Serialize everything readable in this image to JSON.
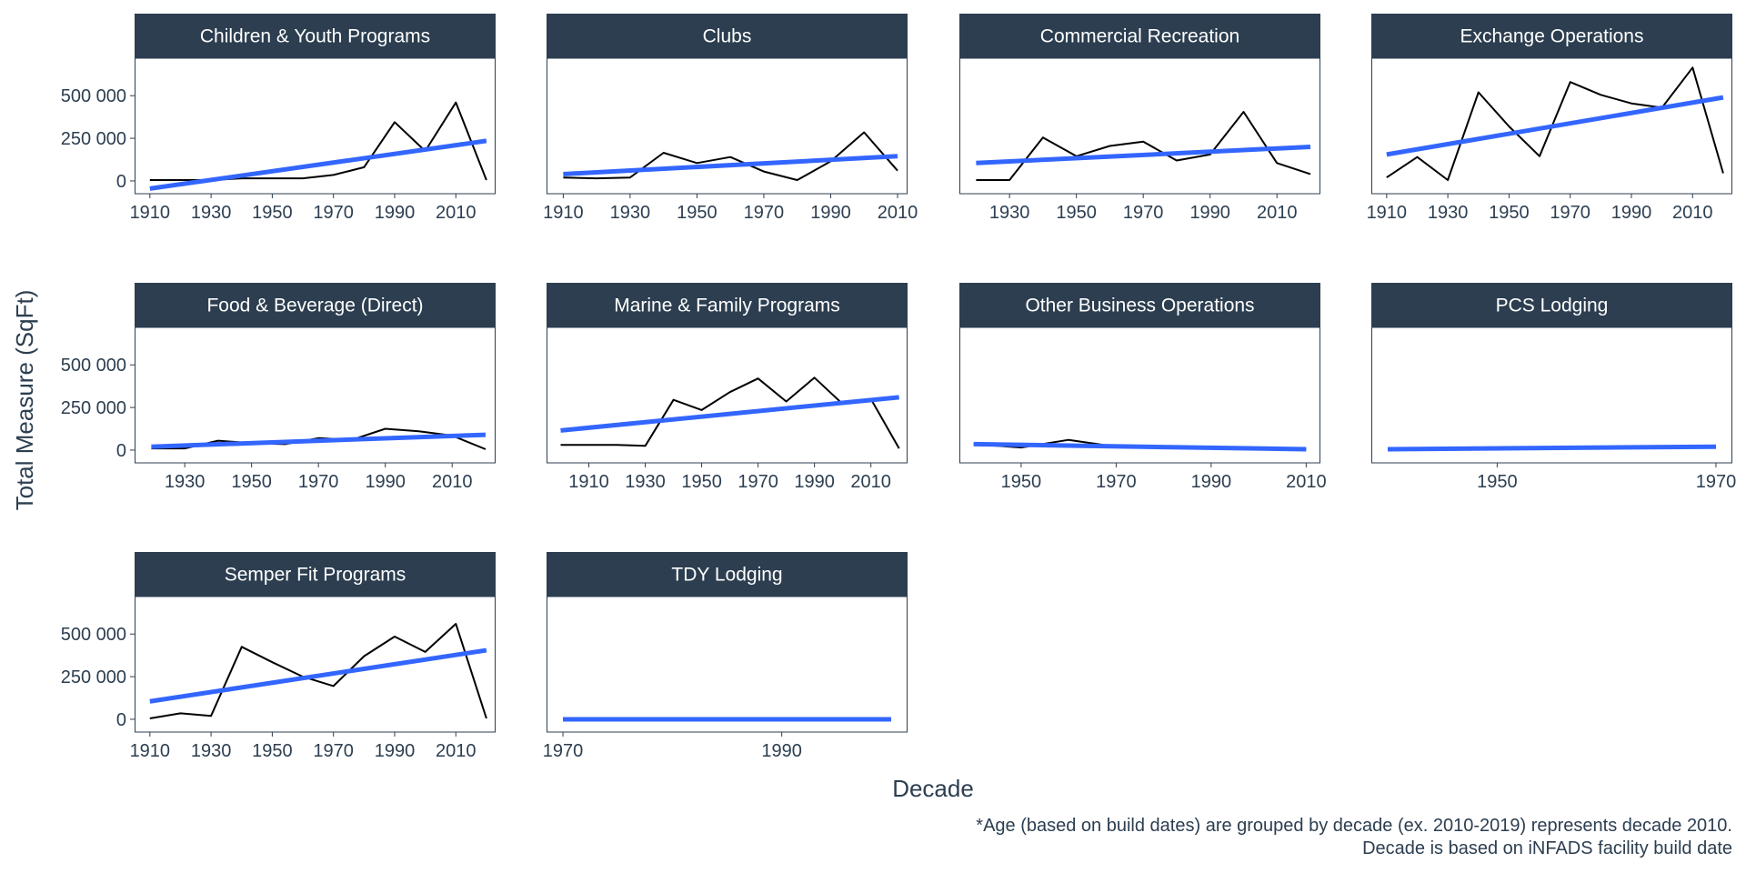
{
  "chart_data": {
    "type": "line",
    "facet": "wrap",
    "ncol": 4,
    "xlabel": "Decade",
    "ylabel": "Total Measure (SqFt)",
    "y_ticks": [
      0,
      250000,
      500000
    ],
    "y_tick_labels": [
      "0",
      "250 000",
      "500 000"
    ],
    "ylim": [
      -75000,
      720000
    ],
    "colors": {
      "data_line": "#000000",
      "trend_line": "#3366ff",
      "strip": "#2c3e50",
      "text": "#2c3e50"
    },
    "panels": [
      {
        "title": "Children & Youth Programs",
        "xlim": [
          1905,
          2023
        ],
        "x_ticks": [
          1910,
          1930,
          1950,
          1970,
          1990,
          2010
        ],
        "x": [
          1910,
          1920,
          1930,
          1940,
          1950,
          1960,
          1970,
          1980,
          1990,
          2000,
          2010,
          2020
        ],
        "y": [
          5000,
          5000,
          5000,
          15000,
          15000,
          15000,
          35000,
          80000,
          345000,
          175000,
          460000,
          5000
        ],
        "trend": [
          [
            1910,
            -45000
          ],
          [
            2020,
            235000
          ]
        ]
      },
      {
        "title": "Clubs",
        "xlim": [
          1905,
          2013
        ],
        "x_ticks": [
          1910,
          1930,
          1950,
          1970,
          1990,
          2010
        ],
        "x": [
          1910,
          1920,
          1930,
          1940,
          1950,
          1960,
          1970,
          1980,
          1990,
          2000,
          2010
        ],
        "y": [
          20000,
          15000,
          20000,
          165000,
          105000,
          140000,
          55000,
          5000,
          115000,
          285000,
          60000
        ],
        "trend": [
          [
            1910,
            40000
          ],
          [
            2010,
            145000
          ]
        ]
      },
      {
        "title": "Commercial Recreation",
        "xlim": [
          1915,
          2023
        ],
        "x_ticks": [
          1930,
          1950,
          1970,
          1990,
          2010
        ],
        "x": [
          1920,
          1930,
          1940,
          1950,
          1960,
          1970,
          1980,
          1990,
          2000,
          2010,
          2020
        ],
        "y": [
          5000,
          5000,
          255000,
          145000,
          205000,
          230000,
          120000,
          155000,
          405000,
          105000,
          40000
        ],
        "trend": [
          [
            1920,
            105000
          ],
          [
            2020,
            200000
          ]
        ]
      },
      {
        "title": "Exchange Operations",
        "xlim": [
          1905,
          2023
        ],
        "x_ticks": [
          1910,
          1930,
          1950,
          1970,
          1990,
          2010
        ],
        "x": [
          1910,
          1920,
          1930,
          1940,
          1950,
          1960,
          1970,
          1980,
          1990,
          2000,
          2010,
          2020
        ],
        "y": [
          20000,
          140000,
          5000,
          520000,
          320000,
          145000,
          580000,
          505000,
          455000,
          430000,
          665000,
          45000
        ],
        "trend": [
          [
            1910,
            155000
          ],
          [
            2020,
            490000
          ]
        ]
      },
      {
        "title": "Food & Beverage (Direct)",
        "xlim": [
          1915,
          2023
        ],
        "x_ticks": [
          1930,
          1950,
          1970,
          1990,
          2010
        ],
        "x": [
          1920,
          1930,
          1940,
          1950,
          1960,
          1970,
          1980,
          1990,
          2000,
          2010,
          2020
        ],
        "y": [
          10000,
          10000,
          55000,
          40000,
          35000,
          70000,
          60000,
          125000,
          110000,
          85000,
          5000
        ],
        "trend": [
          [
            1920,
            20000
          ],
          [
            2020,
            90000
          ]
        ]
      },
      {
        "title": "Marine & Family Programs",
        "xlim": [
          1895,
          2023
        ],
        "x_ticks": [
          1910,
          1930,
          1950,
          1970,
          1990,
          2010
        ],
        "x": [
          1900,
          1910,
          1920,
          1930,
          1940,
          1950,
          1960,
          1970,
          1980,
          1990,
          2000,
          2010,
          2020
        ],
        "y": [
          30000,
          30000,
          30000,
          25000,
          295000,
          235000,
          340000,
          420000,
          285000,
          425000,
          270000,
          300000,
          10000
        ],
        "trend": [
          [
            1900,
            115000
          ],
          [
            2020,
            310000
          ]
        ]
      },
      {
        "title": "Other Business Operations",
        "xlim": [
          1937,
          2013
        ],
        "x_ticks": [
          1950,
          1970,
          1990,
          2010
        ],
        "x": [
          1940,
          1950,
          1960,
          1970,
          1980,
          1990,
          2000,
          2010
        ],
        "y": [
          35000,
          15000,
          60000,
          20000,
          20000,
          15000,
          10000,
          5000
        ],
        "trend": [
          [
            1940,
            35000
          ],
          [
            2010,
            5000
          ]
        ]
      },
      {
        "title": "PCS Lodging",
        "xlim": [
          1938.5,
          1971.5
        ],
        "x_ticks": [
          1950,
          1970
        ],
        "x": [
          1940,
          1950,
          1960,
          1970
        ],
        "y": [
          5000,
          10000,
          15000,
          20000
        ],
        "trend": [
          [
            1940,
            5000
          ],
          [
            1970,
            20000
          ]
        ]
      },
      {
        "title": "Semper Fit Programs",
        "xlim": [
          1905,
          2023
        ],
        "x_ticks": [
          1910,
          1930,
          1950,
          1970,
          1990,
          2010
        ],
        "x": [
          1910,
          1920,
          1930,
          1940,
          1950,
          1960,
          1970,
          1980,
          1990,
          2000,
          2010,
          2020
        ],
        "y": [
          5000,
          35000,
          20000,
          425000,
          335000,
          250000,
          195000,
          370000,
          485000,
          395000,
          560000,
          5000
        ],
        "trend": [
          [
            1910,
            105000
          ],
          [
            2020,
            405000
          ]
        ]
      },
      {
        "title": "TDY Lodging",
        "xlim": [
          1968.5,
          2001.5
        ],
        "x_ticks": [
          1970,
          1990
        ],
        "x": [
          1970,
          1980,
          1990,
          2000
        ],
        "y": [
          0,
          0,
          0,
          0
        ],
        "trend": [
          [
            1970,
            0
          ],
          [
            2000,
            0
          ]
        ]
      }
    ]
  },
  "caption": {
    "line1": "*Age (based on build dates) are grouped by decade (ex. 2010-2019) represents decade 2010.",
    "line2": "Decade is based on iNFADS facility build date"
  }
}
